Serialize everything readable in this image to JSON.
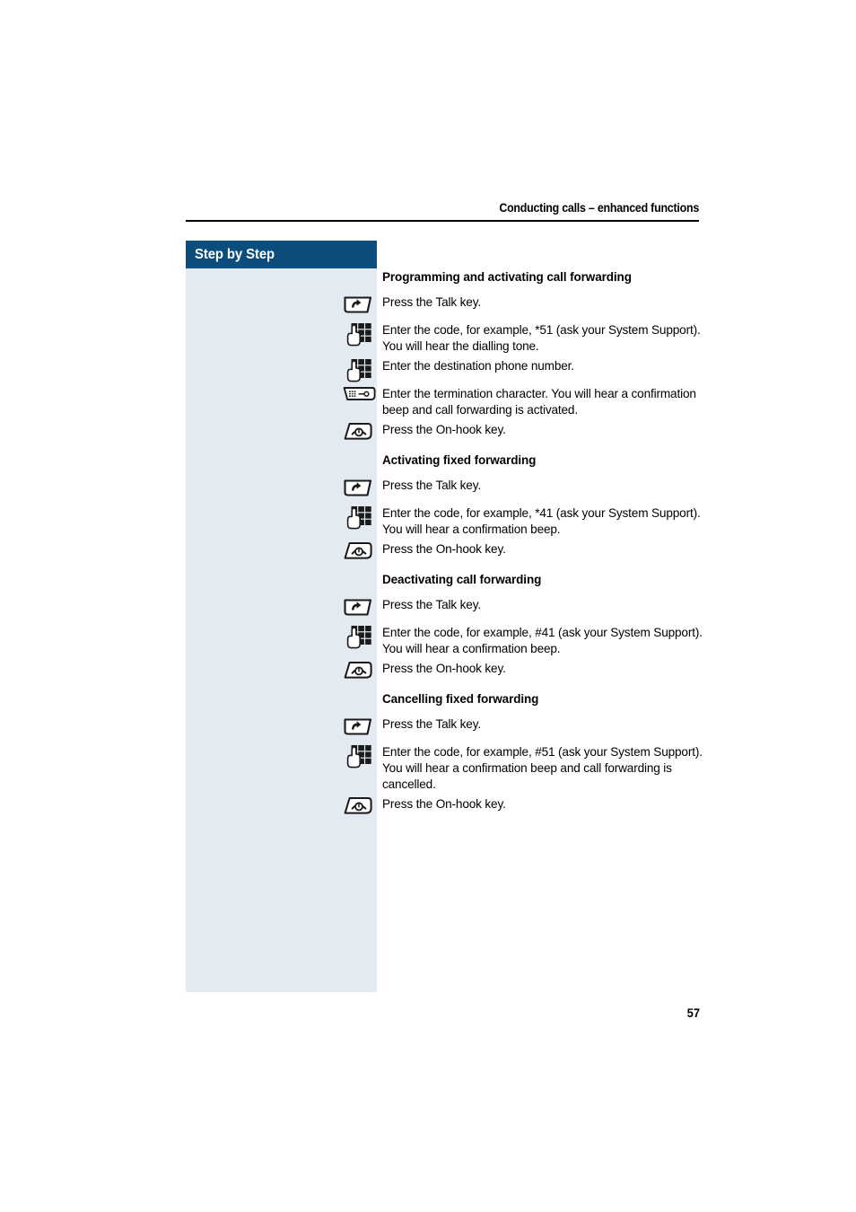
{
  "header": {
    "running_title": "Conducting calls – enhanced functions"
  },
  "sidebar": {
    "title": "Step by Step"
  },
  "page": {
    "number": "57"
  },
  "icons": {
    "talk_key": "talk-key-icon",
    "keypad": "keypad-icon",
    "termination_key": "termination-character-key-icon",
    "on_hook_key": "on-hook-key-icon"
  },
  "sections": [
    {
      "heading": "Programming and activating call forwarding",
      "steps": [
        {
          "icon": "talk-key-icon",
          "text": "Press the Talk key."
        },
        {
          "icon": "keypad-icon",
          "text": "Enter the code, for example, *51 (ask your System Support). You will hear the dialling tone."
        },
        {
          "icon": "keypad-icon",
          "text": "Enter the destination phone number."
        },
        {
          "icon": "termination-character-key-icon",
          "text": "Enter the termination character. You will hear a confirmation beep and call forwarding is activated."
        },
        {
          "icon": "on-hook-key-icon",
          "text": "Press the On-hook key."
        }
      ]
    },
    {
      "heading": "Activating fixed forwarding",
      "steps": [
        {
          "icon": "talk-key-icon",
          "text": "Press the Talk key."
        },
        {
          "icon": "keypad-icon",
          "text": "Enter the code, for example, *41 (ask your System Support). You will hear a confirmation beep."
        },
        {
          "icon": "on-hook-key-icon",
          "text": "Press the On-hook key."
        }
      ]
    },
    {
      "heading": "Deactivating call forwarding",
      "steps": [
        {
          "icon": "talk-key-icon",
          "text": "Press the Talk key."
        },
        {
          "icon": "keypad-icon",
          "text": "Enter the code, for example, #41 (ask your System Support). You will hear a confirmation beep."
        },
        {
          "icon": "on-hook-key-icon",
          "text": "Press the On-hook key."
        }
      ]
    },
    {
      "heading": "Cancelling fixed forwarding",
      "steps": [
        {
          "icon": "talk-key-icon",
          "text": "Press the Talk key."
        },
        {
          "icon": "keypad-icon",
          "text": "Enter the code, for example, #51 (ask your System Support). You will hear a confirmation beep and call forwarding is cancelled."
        },
        {
          "icon": "on-hook-key-icon",
          "text": "Press the On-hook key."
        }
      ]
    }
  ],
  "colors": {
    "sidebar_header": "#0b4d7d",
    "sidebar_body": "#e4eaf1",
    "text": "#000000",
    "page_background": "#ffffff"
  }
}
